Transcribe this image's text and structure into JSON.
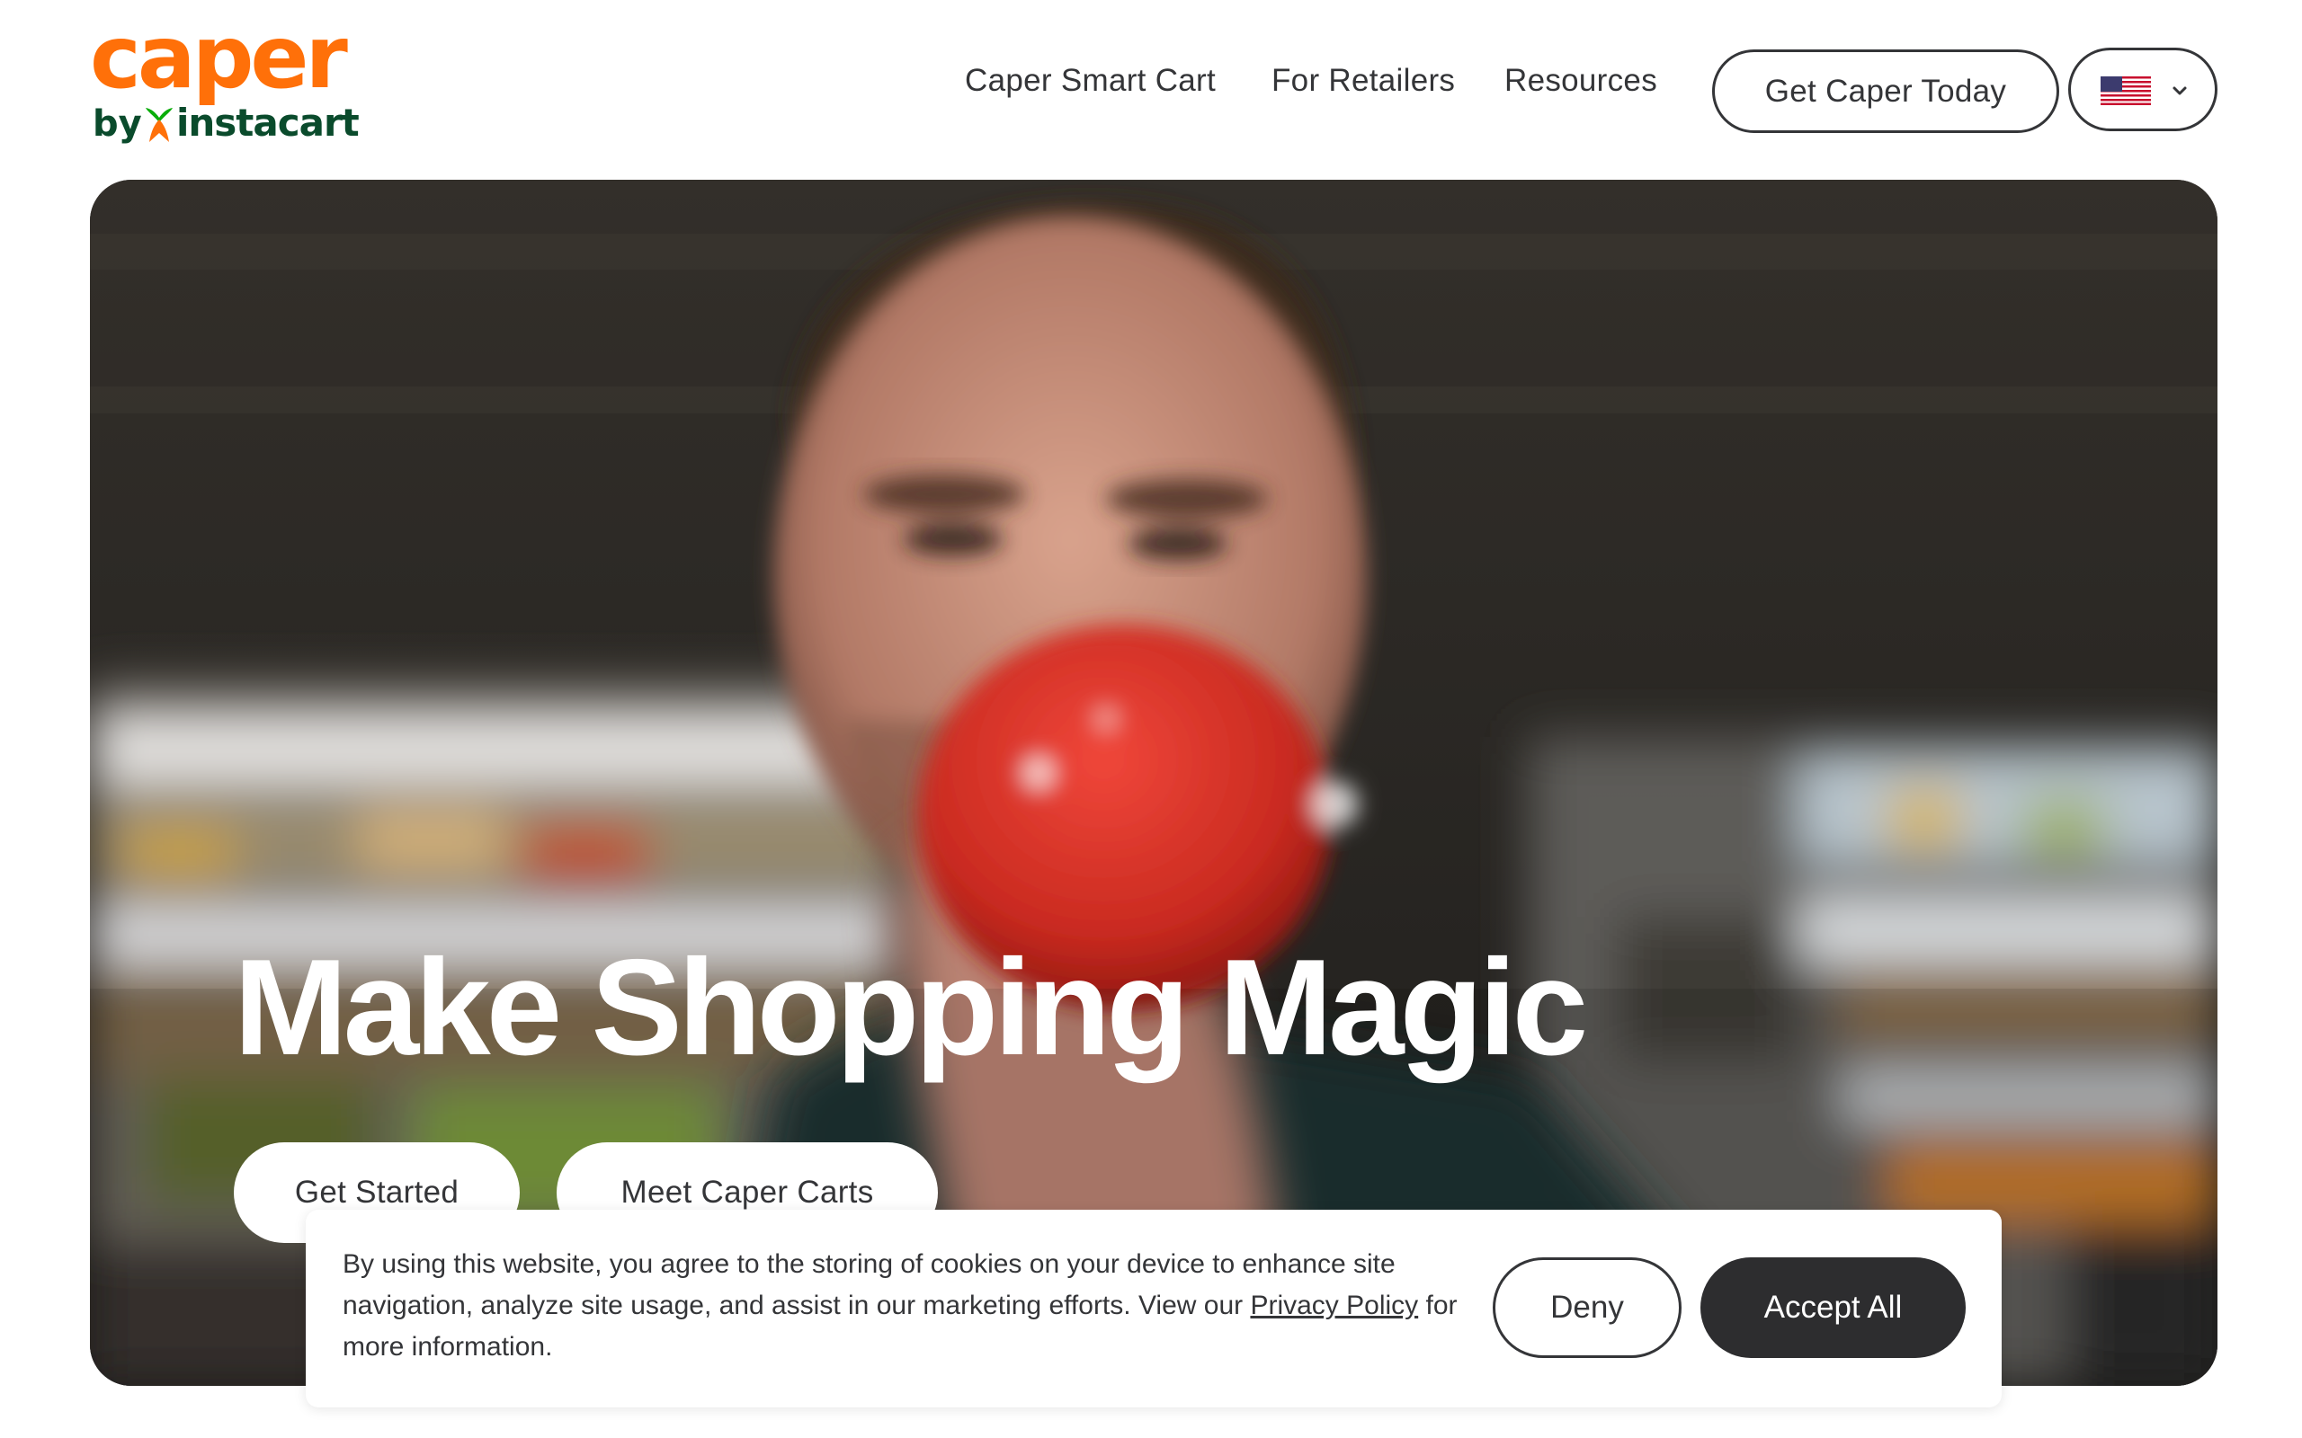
{
  "header": {
    "logo": {
      "word": "caper",
      "by": "by",
      "brand": "instacart",
      "icon": "instacart-carrot-icon"
    },
    "nav": [
      {
        "label": "Caper Smart Cart"
      },
      {
        "label": "For Retailers"
      },
      {
        "label": "Resources"
      }
    ],
    "cta_label": "Get Caper Today",
    "language": {
      "icon": "us-flag-icon",
      "chevron": "chevron-down-icon"
    }
  },
  "hero": {
    "title": "Make Shopping Magic",
    "primary_button": "Get Started",
    "secondary_button": "Meet Caper Carts"
  },
  "cookie_banner": {
    "text_before_link": "By using this website, you agree to the storing of cookies on your device to enhance site navigation, analyze site usage, and assist in our marketing efforts. View our ",
    "link_text": "Privacy Policy",
    "text_after_link": " for more information.",
    "deny_label": "Deny",
    "accept_label": "Accept All"
  },
  "colors": {
    "brand_orange": "#ff7009",
    "brand_green": "#0a4b2c",
    "text_dark": "#343538",
    "accept_button": "#2d2d2f"
  }
}
